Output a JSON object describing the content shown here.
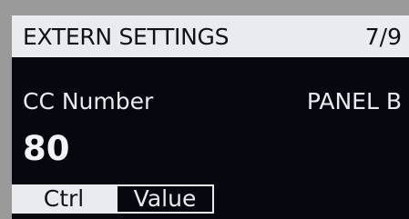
{
  "header": {
    "title": "EXTERN SETTINGS",
    "page_indicator": "7/9"
  },
  "parameter": {
    "label": "CC Number",
    "value": "80"
  },
  "panel": {
    "label": "PANEL B"
  },
  "tabs": [
    {
      "label": "Ctrl",
      "selected": false
    },
    {
      "label": "Value",
      "selected": true
    }
  ],
  "colors": {
    "screen_background": "#060810",
    "foreground": "#e9ebf0",
    "bezel": "#9a9a9a"
  }
}
